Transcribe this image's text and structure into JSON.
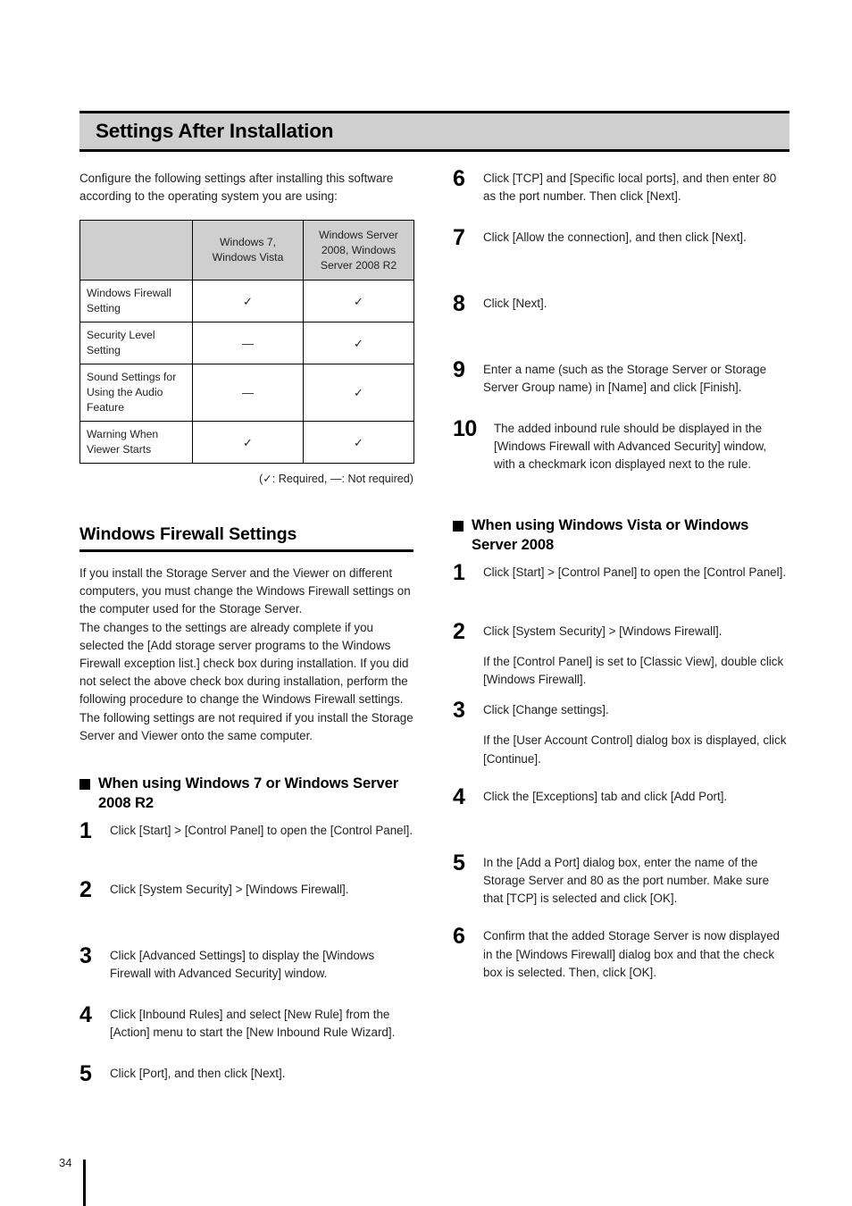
{
  "banner": {
    "title": "Settings After Installation"
  },
  "intro": "Configure the following settings after installing this software according to the operating system you are using:",
  "compat_table": {
    "headers": [
      "",
      "Windows 7, Windows Vista",
      "Windows Server 2008, Windows Server 2008 R2"
    ],
    "rows": [
      {
        "label": "Windows Firewall Setting",
        "win7": "✓",
        "server": "✓"
      },
      {
        "label": "Security Level Setting",
        "win7": "—",
        "server": "✓"
      },
      {
        "label": "Sound Settings for Using the Audio Feature",
        "win7": "—",
        "server": "✓"
      },
      {
        "label": "Warning When Viewer Starts",
        "win7": "✓",
        "server": "✓"
      }
    ],
    "legend": "(✓: Required, —: Not required)"
  },
  "firewall_section": {
    "heading": "Windows Firewall Settings",
    "paragraphs": [
      "If you install the Storage Server and the Viewer on different computers, you must change the Windows Firewall settings on the computer used for the Storage Server.",
      "The changes to the settings are already complete if you selected the [Add storage server programs to the Windows Firewall exception list.] check box during installation. If you did not select the above check box during installation, perform the following procedure to change the Windows Firewall settings.",
      "The following settings are not required if you install the Storage Server and Viewer onto the same computer."
    ]
  },
  "win7_section": {
    "heading": "When using Windows 7 or Windows Server 2008 R2",
    "steps": [
      {
        "num": "1",
        "text": "Click [Start] > [Control Panel] to open the [Control Panel]."
      },
      {
        "num": "2",
        "text": "Click [System Security] > [Windows Firewall]."
      },
      {
        "num": "3",
        "text": "Click [Advanced Settings] to display the [Windows Firewall with Advanced Security] window."
      },
      {
        "num": "4",
        "text": "Click [Inbound Rules] and select [New Rule] from the [Action] menu to start the [New Inbound Rule Wizard]."
      },
      {
        "num": "5",
        "text": "Click [Port], and then click [Next]."
      },
      {
        "num": "6",
        "text": "Click [TCP] and [Specific local ports], and then enter 80 as the port number. Then click [Next]."
      },
      {
        "num": "7",
        "text": "Click [Allow the connection], and then click [Next]."
      },
      {
        "num": "8",
        "text": "Click [Next]."
      },
      {
        "num": "9",
        "text": "Enter a name (such as the Storage Server or Storage Server Group name) in [Name] and click [Finish]."
      },
      {
        "num": "10",
        "text": "The added inbound rule should be displayed in the [Windows Firewall with Advanced Security] window, with a checkmark icon displayed next to the rule."
      }
    ]
  },
  "vista_section": {
    "heading": "When using Windows Vista or Windows Server 2008",
    "steps": [
      {
        "num": "1",
        "text": "Click [Start] > [Control Panel] to open the [Control Panel]."
      },
      {
        "num": "2",
        "text": "Click [System Security] > [Windows Firewall].",
        "note": "If the [Control Panel] is set to [Classic View], double click [Windows Firewall]."
      },
      {
        "num": "3",
        "text": "Click [Change settings].",
        "note": "If the [User Account Control] dialog box is displayed, click [Continue]."
      },
      {
        "num": "4",
        "text": "Click the [Exceptions] tab and click [Add Port]."
      },
      {
        "num": "5",
        "text": "In the [Add a Port] dialog box, enter the name of the Storage Server and 80 as the port number. Make sure that [TCP] is selected and click [OK]."
      },
      {
        "num": "6",
        "text": "Confirm that the added Storage Server is now displayed in the [Windows Firewall] dialog box and that the check box is selected. Then, click [OK]."
      }
    ]
  },
  "footer": {
    "page_number": "34"
  }
}
